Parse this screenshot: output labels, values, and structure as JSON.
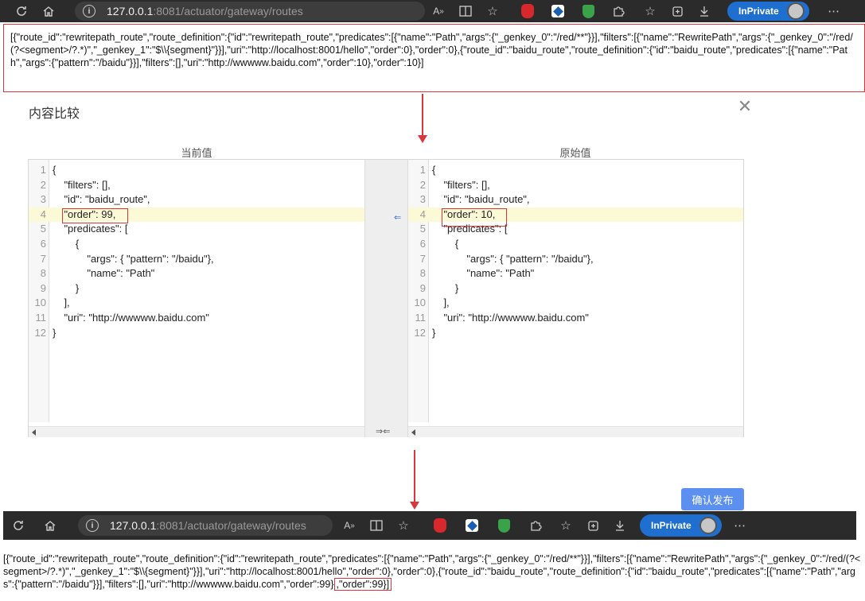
{
  "browser_top": {
    "url_host": "127.0.0.1",
    "url_rest": ":8081/actuator/gateway/routes",
    "inprivate_label": "InPrivate"
  },
  "browser_bottom": {
    "url_host": "127.0.0.1",
    "url_rest": ":8081/actuator/gateway/routes",
    "inprivate_label": "InPrivate"
  },
  "json_before": "[{\"route_id\":\"rewritepath_route\",\"route_definition\":{\"id\":\"rewritepath_route\",\"predicates\":[{\"name\":\"Path\",\"args\":{\"_genkey_0\":\"/red/**\"}}],\"filters\":[{\"name\":\"RewritePath\",\"args\":{\"_genkey_0\":\"/red/(?<segment>/?.*)\",\"_genkey_1\":\"$\\\\{segment}\"}}],\"uri\":\"http://localhost:8001/hello\",\"order\":0},\"order\":0},{\"route_id\":\"baidu_route\",\"route_definition\":{\"id\":\"baidu_route\",\"predicates\":[{\"name\":\"Path\",\"args\":{\"pattern\":\"/baidu\"}}],\"filters\":[],\"uri\":\"http://wwwww.baidu.com\",\"order\":10},\"order\":10}]",
  "json_after_main": "[{\"route_id\":\"rewritepath_route\",\"route_definition\":{\"id\":\"rewritepath_route\",\"predicates\":[{\"name\":\"Path\",\"args\":{\"_genkey_0\":\"/red/**\"}}],\"filters\":[{\"name\":\"RewritePath\",\"args\":{\"_genkey_0\":\"/red/(?<segment>/?.*)\",\"_genkey_1\":\"$\\\\{segment}\"}}],\"uri\":\"http://localhost:8001/hello\",\"order\":0},\"order\":0},{\"route_id\":\"baidu_route\",\"route_definition\":{\"id\":\"baidu_route\",\"predicates\":[{\"name\":\"Path\",\"args\":{\"pattern\":\"/baidu\"}}],\"filters\":[],\"uri\":\"http://wwwww.baidu.com\",\"order\":99}",
  "json_after_highlight": ",\"order\":99}]",
  "dialog": {
    "title": "内容比较",
    "close_glyph": "✕",
    "left_header": "当前值",
    "right_header": "原始值",
    "publish_label": "确认发布"
  },
  "left_lines": [
    {
      "n": "1",
      "t": "{"
    },
    {
      "n": "2",
      "t": "    \"filters\": [],"
    },
    {
      "n": "3",
      "t": "    \"id\": \"baidu_route\","
    },
    {
      "n": "4",
      "t": "    \"order\": 99,"
    },
    {
      "n": "5",
      "t": "    \"predicates\": ["
    },
    {
      "n": "6",
      "t": "        {"
    },
    {
      "n": "7",
      "t": "            \"args\": { \"pattern\": \"/baidu\"},"
    },
    {
      "n": "8",
      "t": "            \"name\": \"Path\""
    },
    {
      "n": "9",
      "t": "        }"
    },
    {
      "n": "10",
      "t": "    ],"
    },
    {
      "n": "11",
      "t": "    \"uri\": \"http://wwwww.baidu.com\""
    },
    {
      "n": "12",
      "t": "}"
    }
  ],
  "right_lines": [
    {
      "n": "1",
      "t": "{"
    },
    {
      "n": "2",
      "t": "    \"filters\": [],"
    },
    {
      "n": "3",
      "t": "    \"id\": \"baidu_route\","
    },
    {
      "n": "4",
      "t": "    \"order\": 10,"
    },
    {
      "n": "5",
      "t": "    \"predicates\": ["
    },
    {
      "n": "6",
      "t": "        {"
    },
    {
      "n": "7",
      "t": "            \"args\": { \"pattern\": \"/baidu\"},"
    },
    {
      "n": "8",
      "t": "            \"name\": \"Path\""
    },
    {
      "n": "9",
      "t": "        }"
    },
    {
      "n": "10",
      "t": "    ],"
    },
    {
      "n": "11",
      "t": "    \"uri\": \"http://wwwww.baidu.com\""
    },
    {
      "n": "12",
      "t": "}"
    }
  ],
  "changed_line": "4",
  "merge_glyph": "⇐",
  "swap_glyph": "⇒⇐",
  "colors": {
    "accent_red": "#d9363e",
    "publish_blue": "#5b8ff0",
    "inprivate_blue": "#1f6fd1",
    "changed_bg": "#fbf9d6"
  }
}
